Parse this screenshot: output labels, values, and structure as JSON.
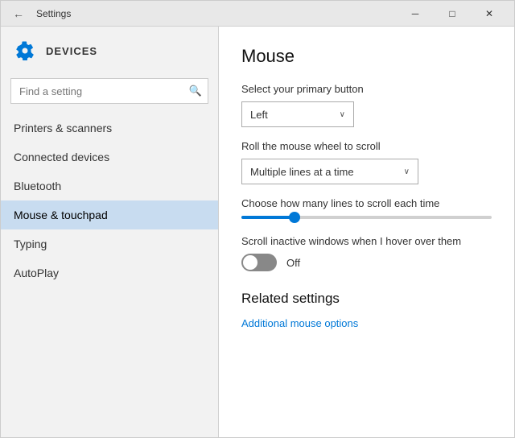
{
  "window": {
    "title": "Settings",
    "minimize_label": "─",
    "maximize_label": "□",
    "close_label": "✕"
  },
  "sidebar": {
    "title": "DEVICES",
    "search_placeholder": "Find a setting",
    "nav_items": [
      {
        "id": "printers",
        "label": "Printers & scanners",
        "active": false
      },
      {
        "id": "connected",
        "label": "Connected devices",
        "active": false
      },
      {
        "id": "bluetooth",
        "label": "Bluetooth",
        "active": false
      },
      {
        "id": "mouse",
        "label": "Mouse & touchpad",
        "active": true
      },
      {
        "id": "typing",
        "label": "Typing",
        "active": false
      },
      {
        "id": "autoplay",
        "label": "AutoPlay",
        "active": false
      }
    ]
  },
  "content": {
    "page_title": "Mouse",
    "primary_button_label": "Select your primary button",
    "primary_button_value": "Left",
    "scroll_label": "Roll the mouse wheel to scroll",
    "scroll_value": "Multiple lines at a time",
    "lines_label": "Choose how many lines to scroll each time",
    "scroll_inactive_label": "Scroll inactive windows when I hover over them",
    "toggle_state": "Off",
    "related_title": "Related settings",
    "related_link": "Additional mouse options"
  },
  "icons": {
    "search": "🔍",
    "gear": "⚙",
    "back": "←"
  }
}
